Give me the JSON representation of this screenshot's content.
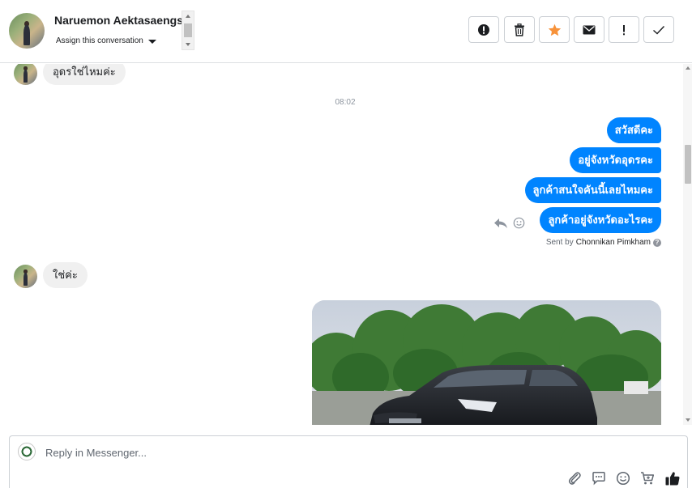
{
  "header": {
    "contact_name": "Naruemon Aektasaengs",
    "assign_label": "Assign this conversation",
    "tools": [
      {
        "id": "spam",
        "icon": "exclamation-circle-icon"
      },
      {
        "id": "delete",
        "icon": "trash-icon"
      },
      {
        "id": "star",
        "icon": "star-icon",
        "color": "#f7923a"
      },
      {
        "id": "email",
        "icon": "envelope-icon"
      },
      {
        "id": "important",
        "icon": "exclamation-icon"
      },
      {
        "id": "done",
        "icon": "check-icon"
      }
    ]
  },
  "conversation": {
    "messages": [
      {
        "direction": "incoming",
        "text": "อุดรใช่ไหมค่ะ"
      },
      {
        "type": "timestamp",
        "text": "08:02"
      },
      {
        "direction": "outgoing",
        "text": "สวัสดีคะ"
      },
      {
        "direction": "outgoing",
        "text": "อยู่จังหวัดอุดรคะ"
      },
      {
        "direction": "outgoing",
        "text": "ลูกค้าสนใจคันนี้เลยไหมคะ"
      },
      {
        "direction": "outgoing",
        "text": "ลูกค้าอยู่จังหวัดอะไรคะ"
      },
      {
        "direction": "incoming",
        "text": "ใช่ค่ะ"
      }
    ],
    "sent_by_prefix": "Sent by",
    "sent_by_name": "Chonnikan Pimkham",
    "outgoing_color": "#0084ff"
  },
  "composer": {
    "placeholder": "Reply in Messenger...",
    "icons": [
      "paperclip-icon",
      "saved-replies-icon",
      "emoji-icon",
      "cart-icon",
      "thumbs-up-icon"
    ]
  }
}
